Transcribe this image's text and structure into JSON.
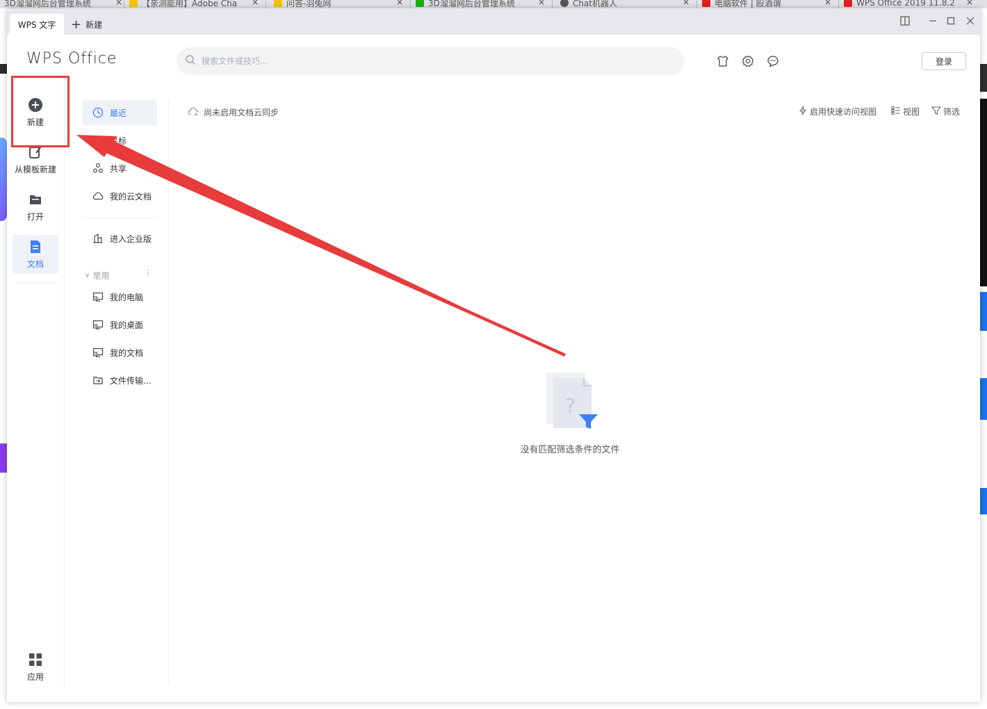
{
  "browser": {
    "tabs": [
      {
        "label": "3D溜溜网后台管理系统",
        "color": "#d9d9d9"
      },
      {
        "label": "【亲测能用】Adobe Cha",
        "color": "#f5c400"
      },
      {
        "label": "问答-羽兔网",
        "color": "#f5c400"
      },
      {
        "label": "3D溜溜网后台管理系统",
        "color": "#1aad19"
      },
      {
        "label": "Chat机器人",
        "color": "#555555"
      },
      {
        "label": "电脑软件 | 殴酒谓",
        "color": "#e02020"
      },
      {
        "label": "WPS Office 2019 11.8.2",
        "color": "#e02020"
      }
    ],
    "close_glyph": "×"
  },
  "window": {
    "tabs": {
      "active_label": "WPS 文字",
      "new_label": "新建"
    },
    "controls": {
      "restore": "▯",
      "minimize": "—",
      "maximize": "□",
      "close": "✕"
    }
  },
  "header": {
    "logo": "WPS Office",
    "search_placeholder": "搜索文件或技巧...",
    "icons": [
      "skin-icon",
      "settings-icon",
      "feedback-icon"
    ],
    "login_label": "登录"
  },
  "rail": {
    "items": [
      {
        "label": "新建",
        "icon": "plus-circle-icon"
      },
      {
        "label": "从模板新建",
        "icon": "template-icon"
      },
      {
        "label": "打开",
        "icon": "folder-icon"
      },
      {
        "label": "文档",
        "icon": "document-icon",
        "active": true
      }
    ],
    "apps_label": "应用"
  },
  "nav": {
    "items": [
      {
        "label": "最近",
        "icon": "clock-icon",
        "active": true
      },
      {
        "label": "星标",
        "icon": "star-icon"
      },
      {
        "label": "共享",
        "icon": "share-icon"
      },
      {
        "label": "我的云文档",
        "icon": "cloud-icon"
      }
    ],
    "enterprise_label": "进入企业版",
    "group_label": "常用",
    "group_items": [
      {
        "label": "我的电脑",
        "icon": "computer-shortcut-icon"
      },
      {
        "label": "我的桌面",
        "icon": "desktop-shortcut-icon"
      },
      {
        "label": "我的文档",
        "icon": "documents-shortcut-icon"
      },
      {
        "label": "文件传输...",
        "icon": "transfer-icon"
      }
    ]
  },
  "main": {
    "sync_label": "尚未启用文档云同步",
    "quick_view_label": "启用快速访问视图",
    "view_label": "视图",
    "filter_label": "筛选",
    "empty_text": "没有匹配筛选条件的文件"
  },
  "colors": {
    "accent": "#417ff9",
    "annotation": "#e83b3b"
  }
}
